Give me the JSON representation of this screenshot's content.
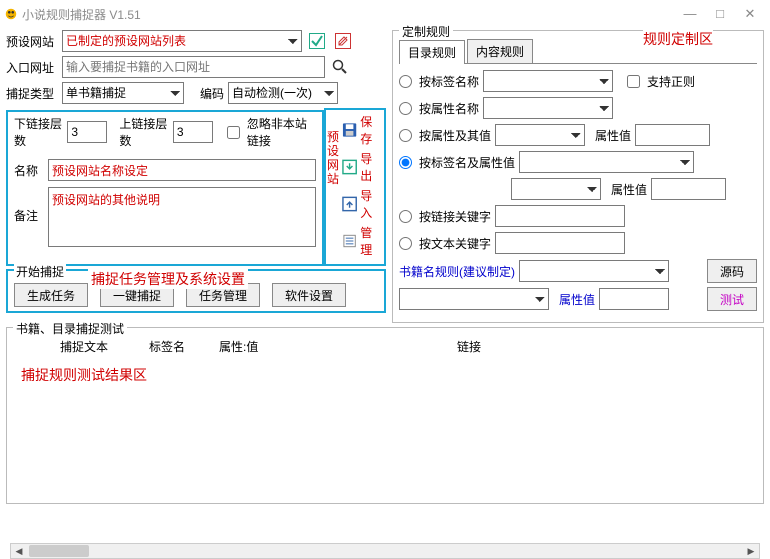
{
  "window": {
    "title": "小说规则捕捉器 V1.51"
  },
  "left": {
    "presetSite": {
      "label": "预设网站",
      "value": "已制定的预设网站列表"
    },
    "entryUrl": {
      "label": "入口网址",
      "placeholder": "输入要捕捉书籍的入口网址"
    },
    "captureType": {
      "label": "捕捉类型",
      "value": "单书籍捕捉"
    },
    "encoding": {
      "label": "编码",
      "value": "自动检测(一次)"
    },
    "downLinkLayers": {
      "label": "下链接层数",
      "value": "3"
    },
    "upLinkLayers": {
      "label": "上链接层数",
      "value": "3"
    },
    "ignoreExt": "忽略非本站链接",
    "name": {
      "label": "名称",
      "value": "预设网站名称设定"
    },
    "note": {
      "label": "备注",
      "value": "预设网站的其他说明"
    }
  },
  "sidebar": {
    "groupLabel": "预设网站",
    "save": "保存",
    "export": "导出",
    "import": "导入",
    "manage": "管理"
  },
  "tasks": {
    "groupLabel": "开始捕捉",
    "annotation": "捕捉任务管理及系统设置",
    "genTask": "生成任务",
    "oneClick": "一键捕捉",
    "taskMgr": "任务管理",
    "settings": "软件设置"
  },
  "rules": {
    "groupLabel": "定制规则",
    "annotation": "规则定制区",
    "tabCatalog": "目录规则",
    "tabContent": "内容规则",
    "byTagName": "按标签名称",
    "supportRegex": "支持正则",
    "byAttrName": "按属性名称",
    "byAttrValue": "按属性及其值",
    "propValue": "属性值",
    "byTagAttr": "按标签名及属性值",
    "byLinkKey": "按链接关键字",
    "byTextKey": "按文本关键字",
    "bookName": {
      "label": "书籍名规则(建议制定)",
      "srcBtn": "源码"
    },
    "propVal2": "属性值",
    "testBtn": "测试"
  },
  "resultArea": {
    "groupLabel": "书籍、目录捕捉测试",
    "colText": "捕捉文本",
    "colTag": "标签名",
    "colAttr": "属性:值",
    "colLink": "链接",
    "annotation": "捕捉规则测试结果区"
  }
}
